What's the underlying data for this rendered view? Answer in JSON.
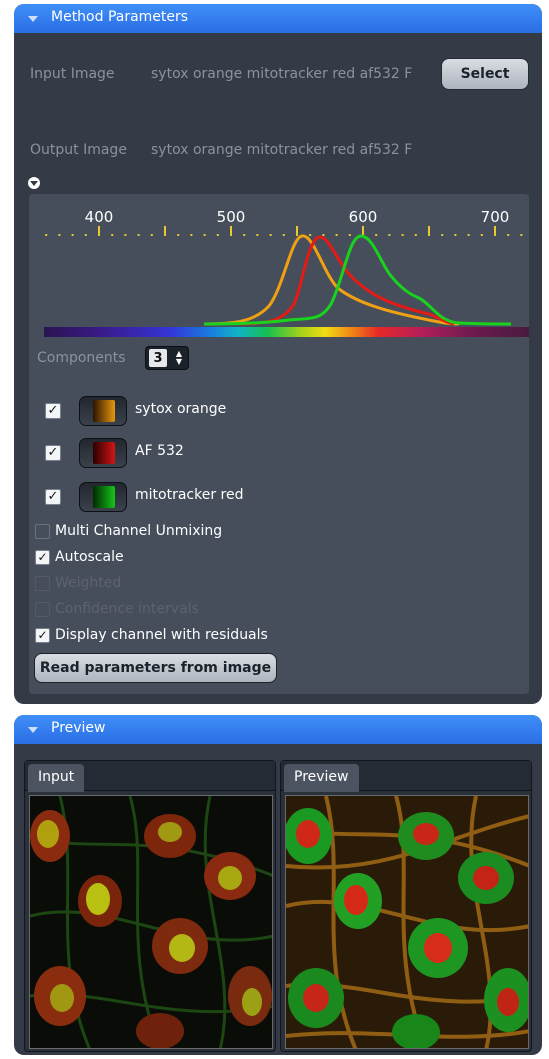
{
  "method_panel": {
    "title": "Method Parameters",
    "input_image_label": "Input Image",
    "input_image_value": "sytox orange mitotracker red af532 F",
    "select_button": "Select",
    "output_image_label": "Output Image",
    "output_image_value": "sytox orange mitotracker red af532 F",
    "spectrum": {
      "axis_labels": [
        "400",
        "500",
        "600",
        "700"
      ],
      "curves": [
        {
          "name": "sytox orange",
          "color": "#f0a012"
        },
        {
          "name": "AF 532",
          "color": "#e61a14"
        },
        {
          "name": "mitotracker red",
          "color": "#19d21e"
        }
      ]
    },
    "components_label": "Components",
    "components_value": "3",
    "components": [
      {
        "name": "sytox orange",
        "checked": true,
        "color": "#e8960f"
      },
      {
        "name": "AF 532",
        "checked": true,
        "color": "#d41414"
      },
      {
        "name": "mitotracker red",
        "checked": true,
        "color": "#18c41a"
      }
    ],
    "options": [
      {
        "label": "Multi Channel Unmixing",
        "checked": false,
        "disabled": false
      },
      {
        "label": "Autoscale",
        "checked": true,
        "disabled": false
      },
      {
        "label": "Weighted",
        "checked": false,
        "disabled": true
      },
      {
        "label": "Confidence intervals",
        "checked": false,
        "disabled": true
      },
      {
        "label": "Display channel with residuals",
        "checked": true,
        "disabled": false
      }
    ],
    "read_button": "Read parameters from image"
  },
  "preview_panel": {
    "title": "Preview",
    "input_tab": "Input",
    "preview_tab": "Preview"
  },
  "check_glyph": "✓"
}
